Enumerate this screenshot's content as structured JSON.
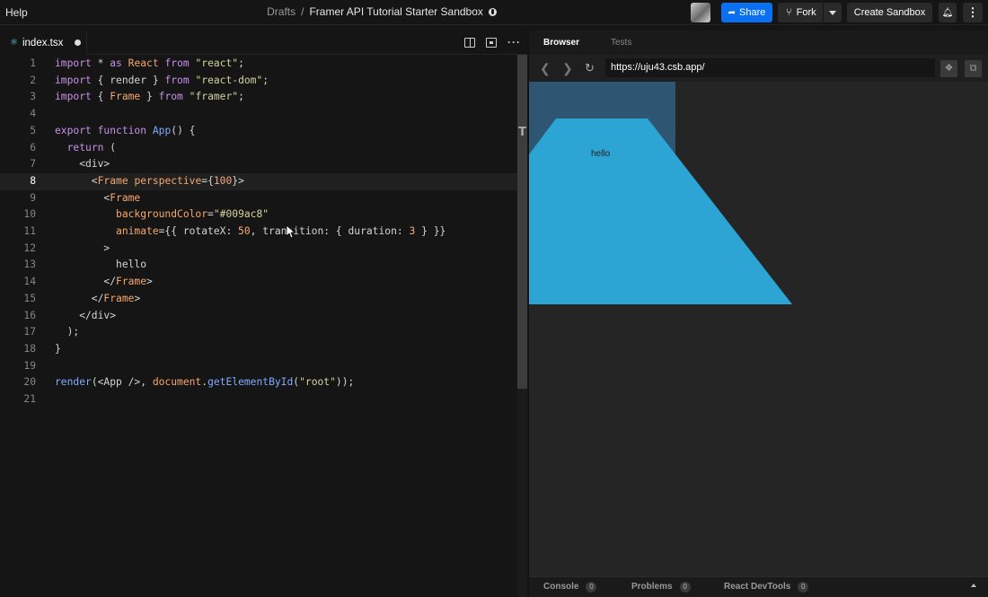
{
  "header": {
    "help": "Help",
    "breadcrumb_root": "Drafts",
    "breadcrumb_sep": "/",
    "sandbox_title": "Framer API Tutorial Starter Sandbox",
    "share_label": "Share",
    "fork_label": "Fork",
    "create_label": "Create Sandbox"
  },
  "editor": {
    "tab_name": "index.tsx",
    "active_line": 8,
    "lines": [
      {
        "n": "1"
      },
      {
        "n": "2"
      },
      {
        "n": "3"
      },
      {
        "n": "4"
      },
      {
        "n": "5"
      },
      {
        "n": "6"
      },
      {
        "n": "7"
      },
      {
        "n": "8"
      },
      {
        "n": "9"
      },
      {
        "n": "10"
      },
      {
        "n": "11"
      },
      {
        "n": "12"
      },
      {
        "n": "13"
      },
      {
        "n": "14"
      },
      {
        "n": "15"
      },
      {
        "n": "16"
      },
      {
        "n": "17"
      },
      {
        "n": "18"
      },
      {
        "n": "19"
      },
      {
        "n": "20"
      },
      {
        "n": "21"
      }
    ],
    "code": [
      "import * as React from \"react\";",
      "import { render } from \"react-dom\";",
      "import { Frame } from \"framer\";",
      "",
      "export function App() {",
      "  return (",
      "    <div>",
      "      <Frame perspective={100}>",
      "        <Frame",
      "          backgroundColor=\"#009ac8\"",
      "          animate={{ rotateX: 50, transition: { duration: 3 } }}",
      "        >",
      "          hello",
      "        </Frame>",
      "      </Frame>",
      "    </div>",
      "  );",
      "}",
      "",
      "render(<App />, document.getElementById(\"root\"));",
      ""
    ]
  },
  "panel": {
    "tab_browser": "Browser",
    "tab_tests": "Tests",
    "url": "https://uju43.csb.app/",
    "preview_text": "hello",
    "frame_color": "#2ca4d4",
    "console_label": "Console",
    "console_count": "0",
    "problems_label": "Problems",
    "problems_count": "0",
    "devtools_label": "React DevTools",
    "devtools_count": "0"
  },
  "colors": {
    "accent": "#0971f1",
    "frame": "#2ca4d4",
    "outline": "#2e5673"
  }
}
